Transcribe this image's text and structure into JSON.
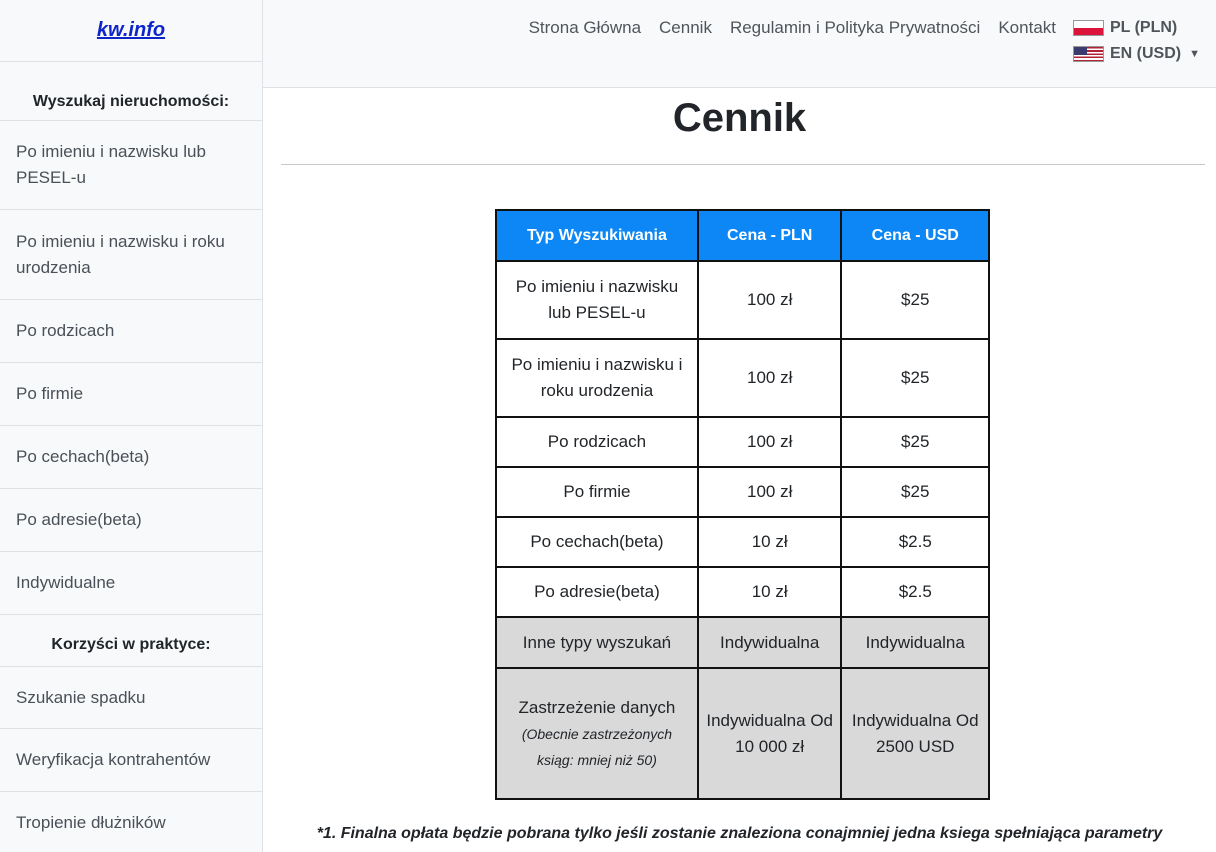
{
  "brand": {
    "name": "kw.info"
  },
  "sidebar": {
    "search_heading": "Wyszukaj nieruchomości:",
    "search_items": [
      {
        "label": "Po imieniu i nazwisku lub PESEL-u"
      },
      {
        "label": "Po imieniu i nazwisku i roku urodzenia"
      },
      {
        "label": "Po rodzicach"
      },
      {
        "label": "Po firmie"
      },
      {
        "label": "Po cechach(beta)"
      },
      {
        "label": "Po adresie(beta)"
      },
      {
        "label": "Indywidualne"
      }
    ],
    "benefits_heading": "Korzyści w praktyce:",
    "benefit_items": [
      {
        "label": "Szukanie spadku"
      },
      {
        "label": "Weryfikacja kontrahentów"
      },
      {
        "label": "Tropienie dłużników"
      }
    ]
  },
  "nav": {
    "links": [
      "Strona Główna",
      "Cennik",
      "Regulamin i Polityka Prywatności",
      "Kontakt"
    ],
    "lang_pl": "PL (PLN)",
    "lang_en": "EN (USD)"
  },
  "main": {
    "title": "Cennik",
    "table": {
      "headers": [
        "Typ Wyszukiwania",
        "Cena - PLN",
        "Cena - USD"
      ],
      "rows": [
        {
          "type": "Po imieniu i nazwisku lub PESEL-u",
          "pln": "100 zł",
          "usd": "$25"
        },
        {
          "type": "Po imieniu i nazwisku i roku urodzenia",
          "pln": "100 zł",
          "usd": "$25"
        },
        {
          "type": "Po rodzicach",
          "pln": "100 zł",
          "usd": "$25"
        },
        {
          "type": "Po firmie",
          "pln": "100 zł",
          "usd": "$25"
        },
        {
          "type": "Po cechach(beta)",
          "pln": "10 zł",
          "usd": "$2.5"
        },
        {
          "type": "Po adresie(beta)",
          "pln": "10 zł",
          "usd": "$2.5"
        },
        {
          "type": "Inne typy wyszukań",
          "pln": "Indywidualna",
          "usd": "Indywidualna"
        },
        {
          "type": "Zastrzeżenie danych",
          "note": "(Obecnie zastrzeżonych ksiąg: mniej niż 50)",
          "pln": "Indywidualna Od 10 000 zł",
          "usd": "Indywidualna Od 2500 USD"
        }
      ]
    },
    "footnote": "*1. Finalna opłata będzie pobrana tylko jeśli zostanie znaleziona conajmniej jedna ksiega spełniająca parametry"
  }
}
